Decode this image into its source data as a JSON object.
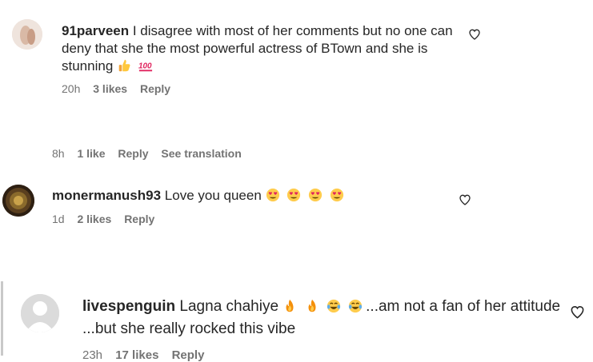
{
  "comments": [
    {
      "username": "91parveen",
      "text": "I disagree with most of her comments but no one can deny that she the most powerful actress of BTown and she is stunning",
      "emojis": [
        "thumbs-up",
        "hundred-points"
      ],
      "time": "20h",
      "likes": "3 likes",
      "reply": "Reply"
    },
    {
      "username": "monermanush93",
      "text": "Love you queen",
      "emojis": [
        "heart-eyes",
        "heart-eyes",
        "heart-eyes",
        "heart-eyes"
      ],
      "time": "1d",
      "likes": "2 likes",
      "reply": "Reply"
    },
    {
      "username": "livespenguin",
      "text_before": "Lagna chahiye",
      "emojis": [
        "fire",
        "fire",
        "tears-of-joy",
        "tears-of-joy"
      ],
      "text_after": "...am not a fan of her attitude ...but she really rocked this vibe",
      "time": "23h",
      "likes": "17 likes",
      "reply": "Reply"
    }
  ],
  "orphan_meta": {
    "time": "8h",
    "likes": "1 like",
    "reply": "Reply",
    "translate": "See translation"
  },
  "icons": {
    "like": "heart-outline-icon"
  }
}
